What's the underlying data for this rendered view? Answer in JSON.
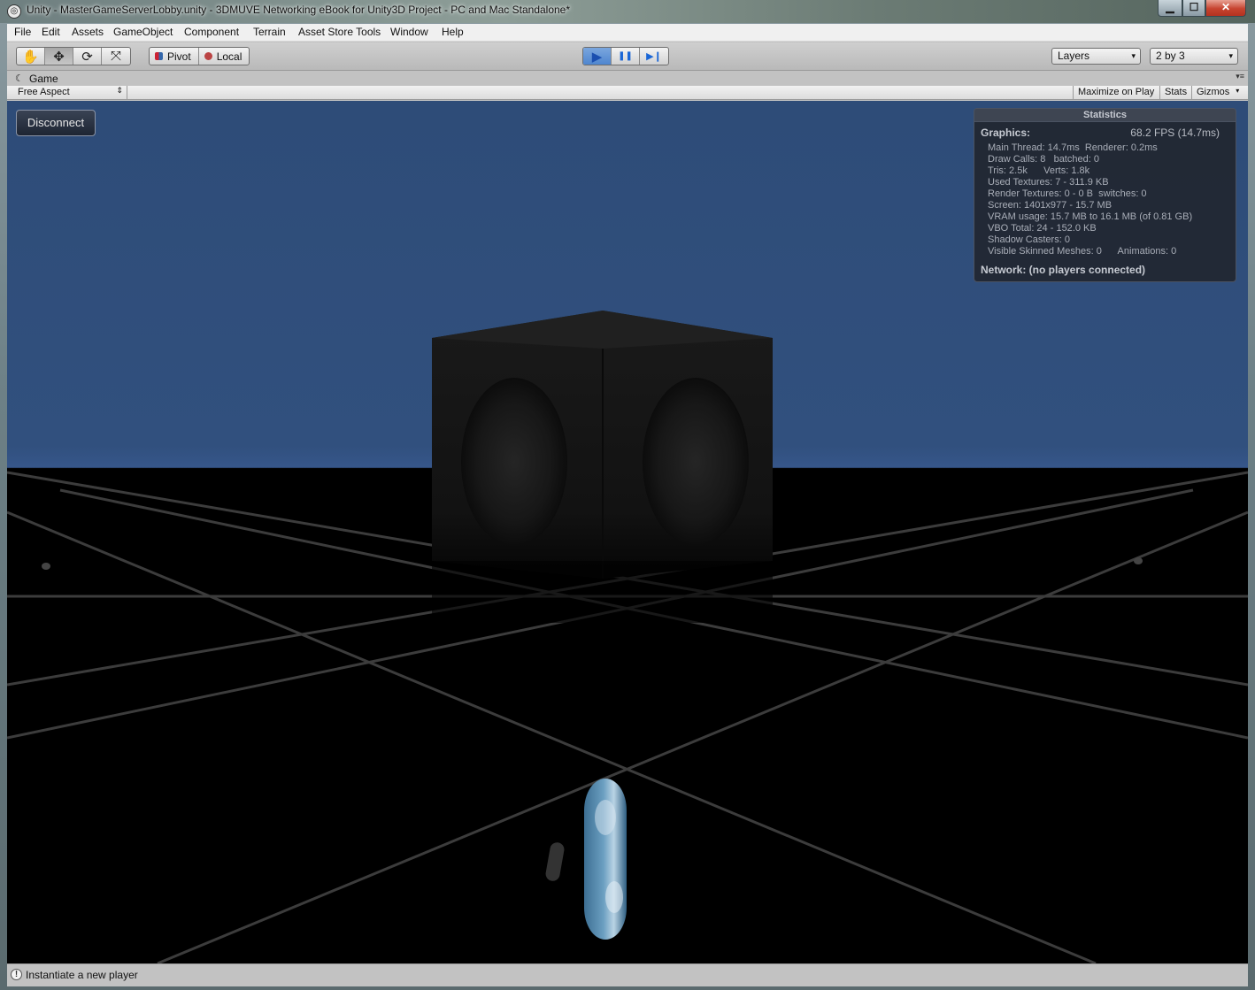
{
  "window": {
    "title": "Unity - MasterGameServerLobby.unity - 3DMUVE Networking eBook for Unity3D Project - PC and Mac Standalone*",
    "min_glyph": "▁",
    "max_glyph": "☐",
    "close_glyph": "✕"
  },
  "menu": {
    "items": [
      "File",
      "Edit",
      "Assets",
      "GameObject",
      "Component",
      "Terrain",
      "Asset Store Tools",
      "Window",
      "Help"
    ]
  },
  "toolbar": {
    "transform_tools": [
      {
        "icon": "hand-icon",
        "glyph": "✋"
      },
      {
        "icon": "move-icon",
        "glyph": "✥"
      },
      {
        "icon": "rotate-icon",
        "glyph": "⟳"
      },
      {
        "icon": "scale-icon",
        "glyph": "⤧"
      }
    ],
    "pivot_label": "Pivot",
    "local_label": "Local",
    "play_glyph": "▶",
    "pause_glyph": "❚❚",
    "step_glyph": "▶❙",
    "layers_label": "Layers",
    "layout_label": "2 by 3",
    "caret": "▾"
  },
  "game_view": {
    "tab_label": "Game",
    "tab_icon_glyph": "☾",
    "tab_menu_glyph": "▾≡",
    "aspect_label": "Free Aspect",
    "aspect_caret": "⇕",
    "maximize_label": "Maximize on Play",
    "stats_label": "Stats",
    "gizmos_label": "Gizmos",
    "gizmos_caret": "▾",
    "sky_color": "#2f4f7d",
    "ground_color": "#000000"
  },
  "overlay": {
    "disconnect_label": "Disconnect"
  },
  "statistics": {
    "title": "Statistics",
    "graphics_label": "Graphics:",
    "fps": "68.2 FPS (14.7ms)",
    "lines": [
      "Main Thread: 14.7ms  Renderer: 0.2ms",
      "Draw Calls: 8   batched: 0",
      "Tris: 2.5k      Verts: 1.8k",
      "Used Textures: 7 - 311.9 KB",
      "Render Textures: 0 - 0 B  switches: 0",
      "Screen: 1401x977 - 15.7 MB",
      "VRAM usage: 15.7 MB to 16.1 MB (of 0.81 GB)",
      "VBO Total: 24 - 152.0 KB",
      "Shadow Casters: 0",
      "Visible Skinned Meshes: 0      Animations: 0"
    ],
    "network": "Network: (no players connected)"
  },
  "status": {
    "icon_glyph": "!",
    "message": "Instantiate a new player"
  }
}
